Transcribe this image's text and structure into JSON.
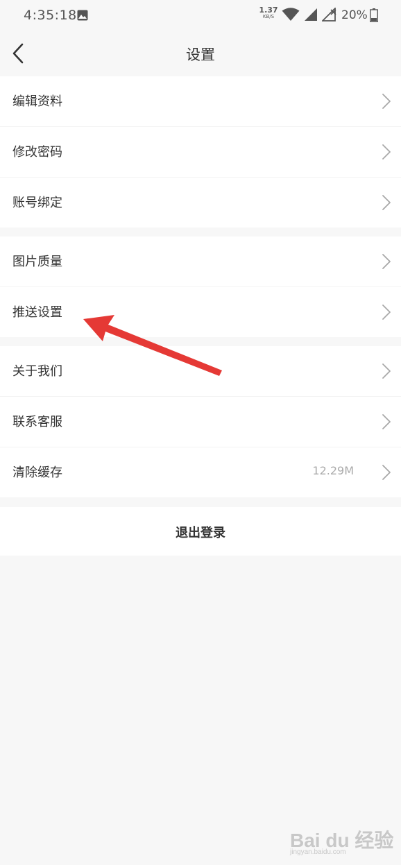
{
  "status_bar": {
    "time": "4:35:18",
    "net_speed_value": "1.37",
    "net_speed_unit": "KB/S",
    "battery_percent": "20%"
  },
  "nav": {
    "title": "设置"
  },
  "groups": {
    "account": {
      "items": [
        {
          "label": "编辑资料"
        },
        {
          "label": "修改密码"
        },
        {
          "label": "账号绑定"
        }
      ]
    },
    "prefs": {
      "items": [
        {
          "label": "图片质量"
        },
        {
          "label": "推送设置"
        }
      ]
    },
    "about": {
      "items": [
        {
          "label": "关于我们"
        },
        {
          "label": "联系客服"
        },
        {
          "label": "清除缓存",
          "value": "12.29M"
        }
      ]
    }
  },
  "logout": {
    "label": "退出登录"
  },
  "watermark": {
    "brand": "Bai du 经验",
    "url": "jingyan.baidu.com"
  },
  "colors": {
    "background": "#f7f7f7",
    "row_background": "#ffffff",
    "annotation_arrow": "#e53935",
    "chevron": "#a8a8a8"
  }
}
